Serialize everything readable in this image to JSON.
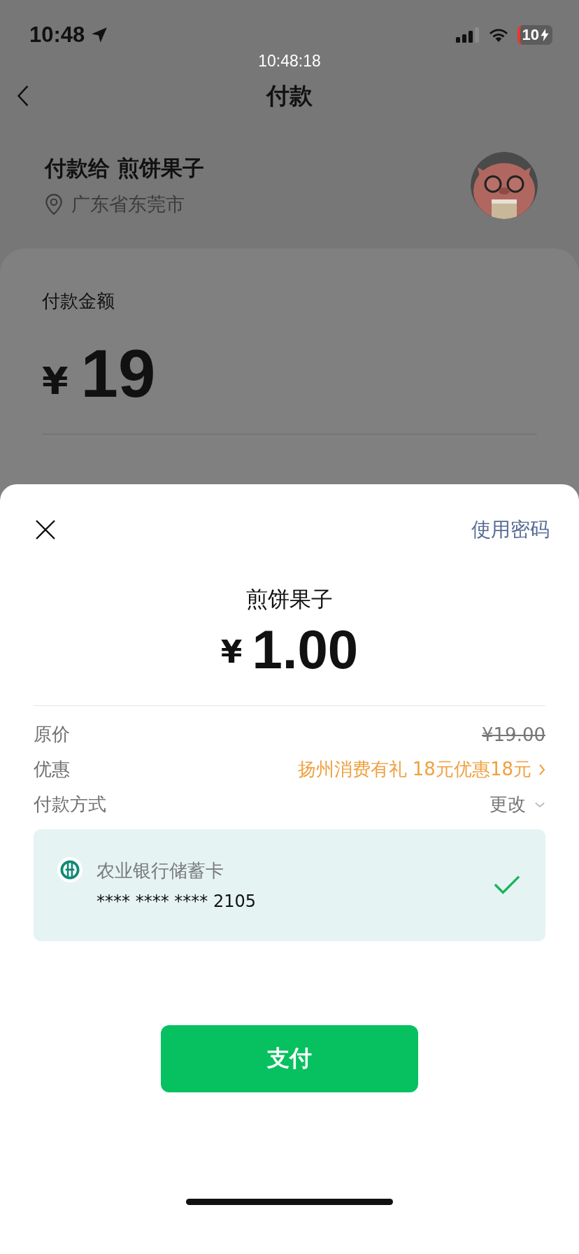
{
  "status_bar": {
    "time": "10:48",
    "battery": "10"
  },
  "capture_time": "10:48:18",
  "nav": {
    "title": "付款"
  },
  "payee": {
    "title": "付款给 煎饼果子",
    "location": "广东省东莞市"
  },
  "amount_card": {
    "label": "付款金额",
    "currency": "¥",
    "amount": "19"
  },
  "sheet": {
    "password_link": "使用密码",
    "merchant": "煎饼果子",
    "currency": "¥",
    "amount": "1.00",
    "rows": [
      {
        "kind": "strike",
        "label": "原价",
        "value": "¥19.00"
      },
      {
        "kind": "offer",
        "label": "优惠",
        "value": "扬州消费有礼 18元优惠18元"
      },
      {
        "kind": "change",
        "label": "付款方式",
        "value": "更改"
      }
    ],
    "payment_methods": [
      {
        "name": "农业银行储蓄卡",
        "number": "**** **** **** 2105",
        "selected": true
      }
    ],
    "pay_button": "支付"
  }
}
